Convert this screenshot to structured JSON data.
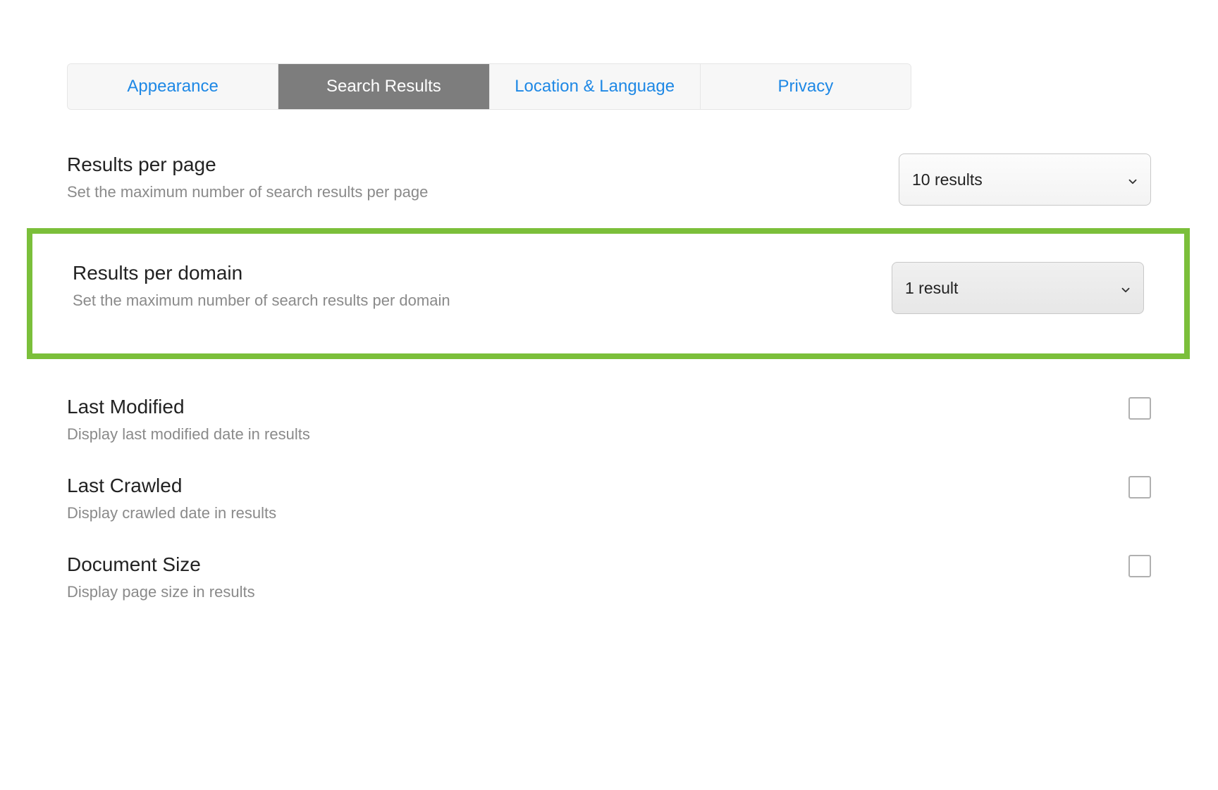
{
  "tabs": [
    {
      "label": "Appearance",
      "active": false
    },
    {
      "label": "Search Results",
      "active": true
    },
    {
      "label": "Location & Language",
      "active": false
    },
    {
      "label": "Privacy",
      "active": false
    }
  ],
  "settings": {
    "results_per_page": {
      "title": "Results per page",
      "desc": "Set the maximum number of search results per page",
      "selected": "10 results"
    },
    "results_per_domain": {
      "title": "Results per domain",
      "desc": "Set the maximum number of search results per domain",
      "selected": "1 result"
    },
    "last_modified": {
      "title": "Last Modified",
      "desc": "Display last modified date in results",
      "checked": false
    },
    "last_crawled": {
      "title": "Last Crawled",
      "desc": "Display crawled date in results",
      "checked": false
    },
    "document_size": {
      "title": "Document Size",
      "desc": "Display page size in results",
      "checked": false
    }
  }
}
